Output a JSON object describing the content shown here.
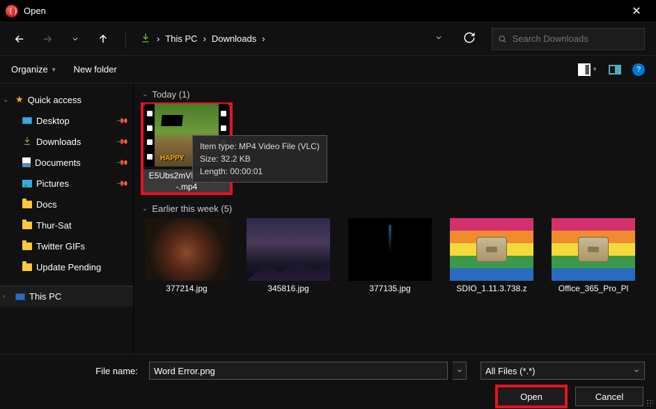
{
  "titlebar": {
    "title": "Open"
  },
  "nav": {
    "breadcrumb": [
      "This PC",
      "Downloads"
    ],
    "search_placeholder": "Search Downloads"
  },
  "toolbar": {
    "organize": "Organize",
    "new_folder": "New folder"
  },
  "sidebar": {
    "quick_access": "Quick access",
    "items": [
      {
        "label": "Desktop"
      },
      {
        "label": "Downloads"
      },
      {
        "label": "Documents"
      },
      {
        "label": "Pictures"
      },
      {
        "label": "Docs"
      },
      {
        "label": "Thur-Sat"
      },
      {
        "label": "Twitter GIFs"
      },
      {
        "label": "Update Pending"
      }
    ],
    "this_pc": "This PC"
  },
  "groups": [
    {
      "header": "Today (1)",
      "items": [
        {
          "name": "E5Ubs2mVEAkKQC-.mp4"
        }
      ]
    },
    {
      "header": "Earlier this week (5)",
      "items": [
        {
          "name": "377214.jpg"
        },
        {
          "name": "345816.jpg"
        },
        {
          "name": "377135.jpg"
        },
        {
          "name": "SDIO_1.11.3.738.z"
        },
        {
          "name": "Office_365_Pro_Pl"
        }
      ]
    }
  ],
  "tooltip": {
    "line1": "Item type: MP4 Video File (VLC)",
    "line2": "Size: 32.2 KB",
    "line3": "Length: 00:00:01"
  },
  "thumb_text": "HAPPY",
  "footer": {
    "filename_label": "File name:",
    "filename_value": "Word Error.png",
    "filter": "All Files (*.*)",
    "open": "Open",
    "cancel": "Cancel"
  }
}
